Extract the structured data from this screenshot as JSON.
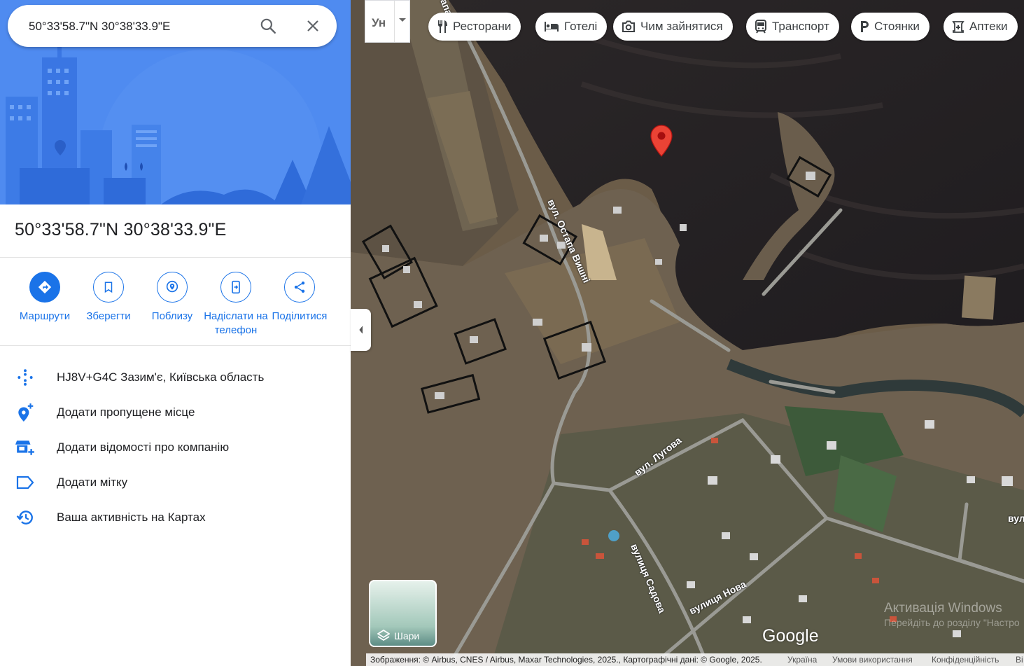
{
  "search": {
    "value": "50°33'58.7\"N 30°38'33.9\"E"
  },
  "place": {
    "title": "50°33'58.7\"N 30°38'33.9\"E"
  },
  "actions": [
    {
      "label": "Маршрути",
      "icon": "directions-icon"
    },
    {
      "label": "Зберегти",
      "icon": "bookmark-icon"
    },
    {
      "label": "Поблизу",
      "icon": "nearby-icon"
    },
    {
      "label": "Надіслати на телефон",
      "icon": "send-to-phone-icon"
    },
    {
      "label": "Поділитися",
      "icon": "share-icon"
    }
  ],
  "info_rows": [
    {
      "text": "HJ8V+G4C Зазим'є, Київська область",
      "icon": "plus-code-icon"
    },
    {
      "text": "Додати пропущене місце",
      "icon": "add-location-icon"
    },
    {
      "text": "Додати відомості про компанію",
      "icon": "add-business-icon"
    },
    {
      "text": "Додати мітку",
      "icon": "label-icon"
    },
    {
      "text": "Ваша активність на Картах",
      "icon": "history-icon"
    }
  ],
  "map": {
    "language_toggle": "Ун",
    "chips": [
      {
        "label": "Ресторани",
        "icon": "restaurant-icon"
      },
      {
        "label": "Готелі",
        "icon": "hotel-icon"
      },
      {
        "label": "Чим зайнятися",
        "icon": "camera-icon"
      },
      {
        "label": "Транспорт",
        "icon": "transit-icon"
      },
      {
        "label": "Стоянки",
        "icon": "parking-icon"
      },
      {
        "label": "Аптеки",
        "icon": "pharmacy-icon"
      }
    ],
    "streets": {
      "ostapa": "вул. Остапа Вишні",
      "luhova": "вул. Лугова",
      "sadova": "вулиця Садова",
      "nova": "вулиця Нова",
      "edge": "вул",
      "top": "апа"
    },
    "layers_label": "Шари",
    "logo": "Google",
    "watermark_title": "Активація Windows",
    "watermark_sub": "Перейдіть до розділу \"Настро",
    "footer": {
      "attribution": "Зображення: © Airbus, CNES / Airbus, Maxar Technologies, 2025., Картографічні дані: © Google, 2025.",
      "country": "Україна",
      "terms": "Умови використання",
      "privacy": "Конфіденційність",
      "more": "Ві"
    },
    "colors": {
      "accent": "#1a73e8",
      "pin": "#ea4335",
      "hero": "#4f8bf0"
    }
  }
}
